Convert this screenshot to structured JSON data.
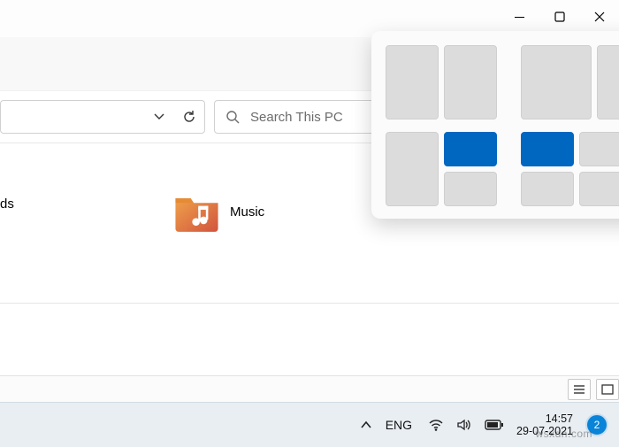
{
  "window_controls": {
    "minimize": "Minimize",
    "maximize": "Maximize",
    "close": "Close"
  },
  "address_bar": {
    "history_dropdown": "Recent locations",
    "refresh": "Refresh"
  },
  "search": {
    "placeholder": "Search This PC"
  },
  "content": {
    "downloads_label_tail": "ds",
    "music_label": "Music"
  },
  "snap_layouts": {
    "layouts": [
      {
        "id": "two-half",
        "selected_tile": null
      },
      {
        "id": "two-third",
        "selected_tile": null
      },
      {
        "id": "left-and-stack",
        "selected_tile": 2
      },
      {
        "id": "quadrants",
        "selected_tile": 1
      }
    ]
  },
  "statusbar": {
    "details_view": "Details view",
    "tiles_view": "Large icons view"
  },
  "taskbar": {
    "overflow": "Show hidden icons",
    "lang": "ENG",
    "wifi": "Wi-Fi",
    "volume": "Volume",
    "battery": "Battery",
    "time": "14:57",
    "date": "29-07-2021",
    "watermark": "wsxdn.com",
    "notifications_count": "2"
  }
}
